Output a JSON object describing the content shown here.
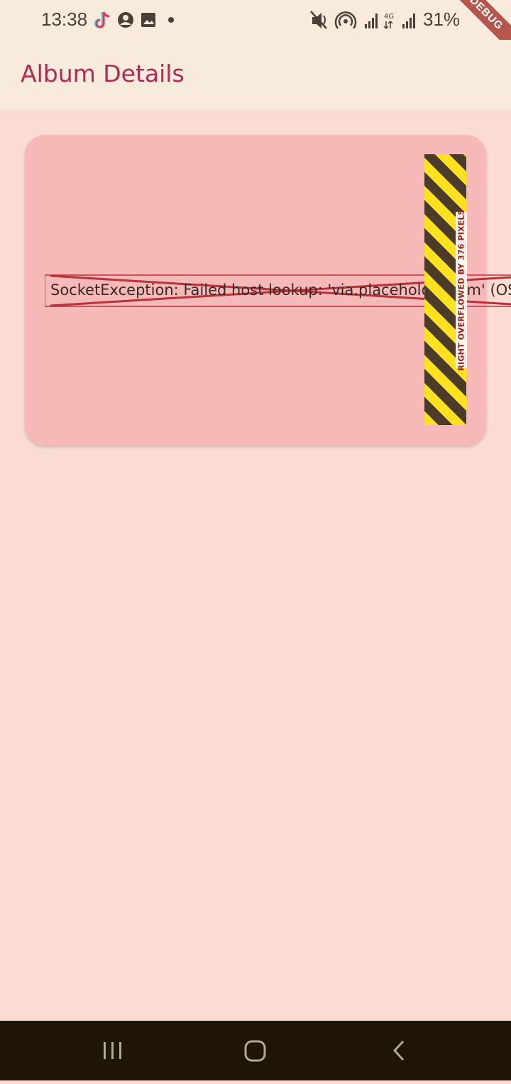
{
  "status_bar": {
    "time": "13:38",
    "battery": "31%",
    "left_icons": [
      "tiktok-icon",
      "account-circle-icon",
      "image-icon",
      "dot-icon"
    ],
    "right_icons": [
      "mute-icon",
      "hotspot-icon",
      "signal-icon",
      "4g-icon",
      "signal-icon"
    ]
  },
  "debug_banner": "DEBUG",
  "app_bar": {
    "title": "Album Details"
  },
  "card": {
    "error_text": "SocketException: Failed host lookup: 'via.placeholder.com' (OS E",
    "overflow_label": "RIGHT OVERFLOWED BY 376 PIXELS"
  },
  "nav_bar": {
    "buttons": [
      "recent-apps-icon",
      "home-icon",
      "back-icon"
    ]
  },
  "colors": {
    "accent": "#b22a50",
    "card": "#f7b9b8",
    "background": "#fbdcd2",
    "app_bar": "#f8ebdb"
  }
}
